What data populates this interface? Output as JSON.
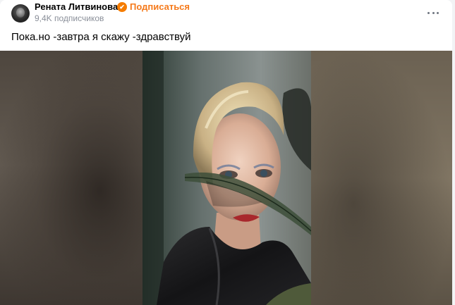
{
  "header": {
    "author_name": "Рената Литвинова",
    "verified_icon": "✔",
    "subscribe_label": "Подписаться",
    "subscribers": "9,4K подписчиков"
  },
  "post": {
    "text": "Пока.но -завтра я скажу -здравствуй"
  },
  "icons": {
    "avatar": "avatar",
    "verified": "verified-badge-icon",
    "more": "more-horizontal-icon"
  },
  "colors": {
    "accent": "#f5791a",
    "verified": "#f57c00",
    "muted_text": "#8a8f99"
  }
}
